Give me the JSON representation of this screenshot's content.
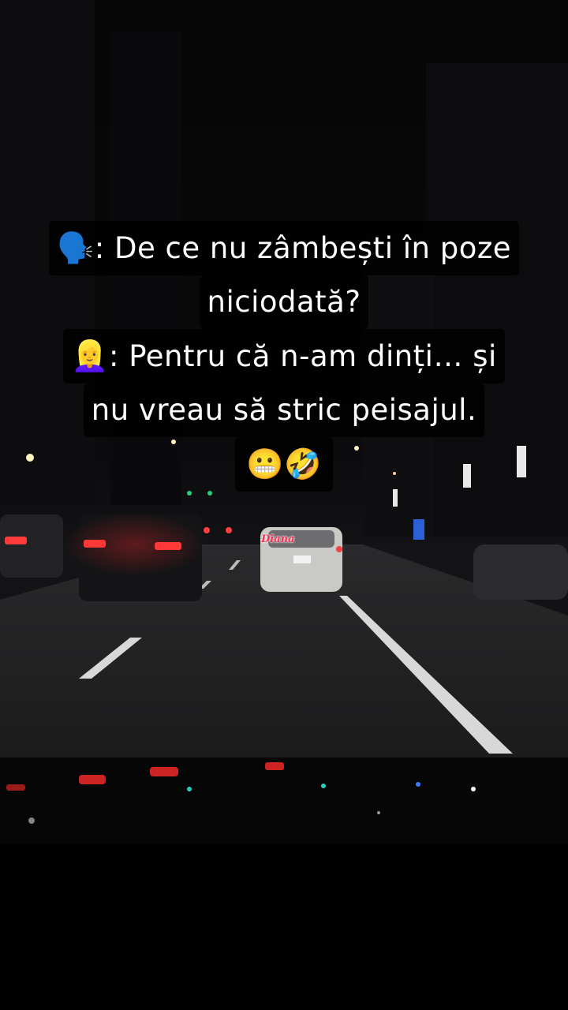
{
  "caption": {
    "line1_icon": "🗣️",
    "line1_text": ": De ce nu zâmbești în poze",
    "line2_text": "niciodată?",
    "line3_icon": "👱‍♀️",
    "line3_text": ": Pentru că n-am dinți… și",
    "line4_text": "nu vreau să stric peisajul.",
    "line5_emojis": "😬🤣"
  },
  "watermark": {
    "text": "Diana"
  },
  "icons": {
    "speaker": "speaking-head-icon",
    "woman": "blond-woman-icon",
    "grimace": "grimacing-face-icon",
    "laugh": "rolling-laughing-icon"
  },
  "colors": {
    "background": "#000000",
    "text": "#ffffff",
    "watermark": "#ff2d55"
  }
}
